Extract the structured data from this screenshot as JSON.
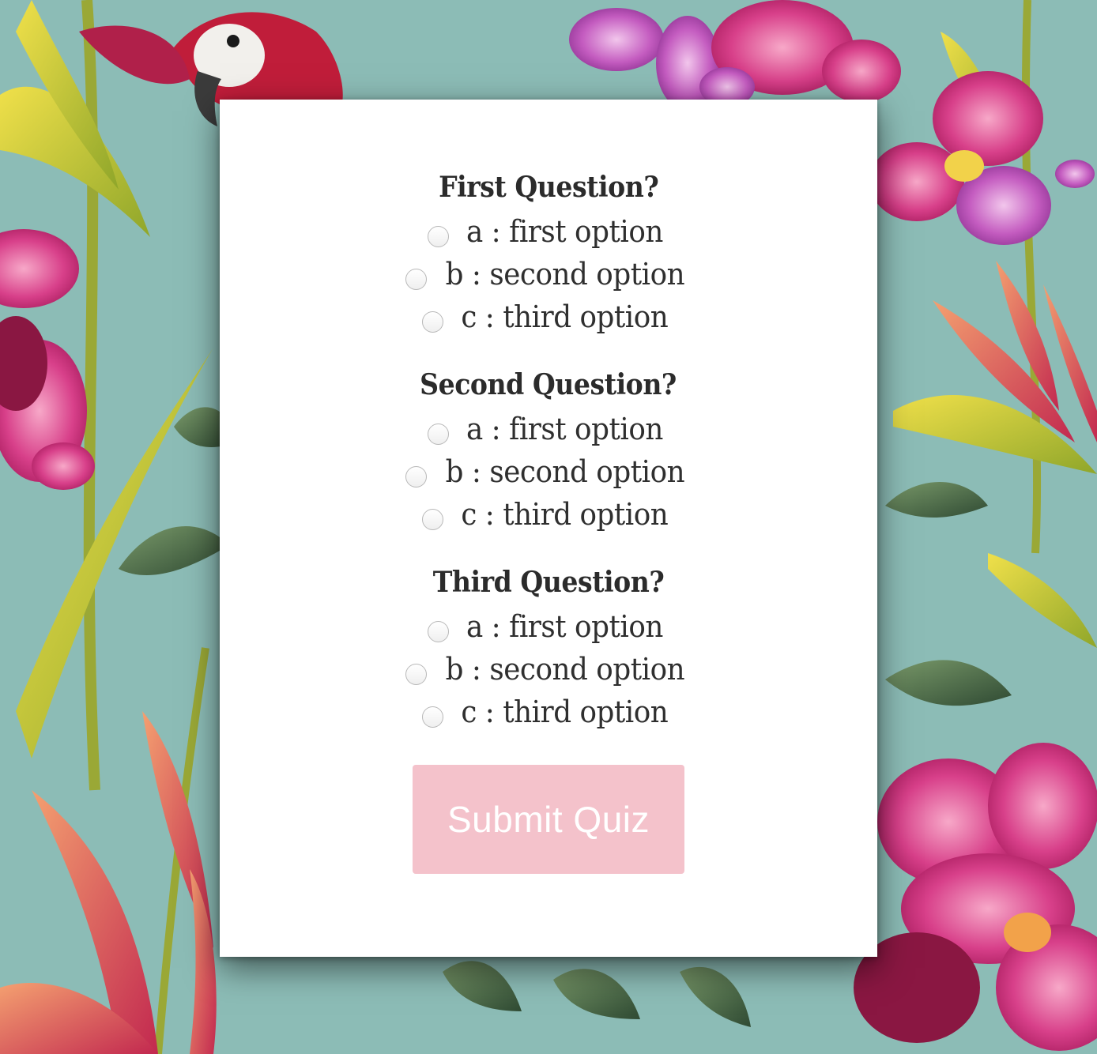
{
  "colors": {
    "background_teal": "#8cbcb6",
    "card": "#ffffff",
    "submit_button": "#f4c2cb",
    "text": "#2f2f2f"
  },
  "quiz": {
    "questions": [
      {
        "title": "First Question?",
        "options": [
          "a : first option",
          "b : second option",
          "c : third option"
        ]
      },
      {
        "title": "Second Question?",
        "options": [
          "a : first option",
          "b : second option",
          "c : third option"
        ]
      },
      {
        "title": "Third Question?",
        "options": [
          "a : first option",
          "b : second option",
          "c : third option"
        ]
      }
    ],
    "submit_label": "Submit Quiz"
  }
}
